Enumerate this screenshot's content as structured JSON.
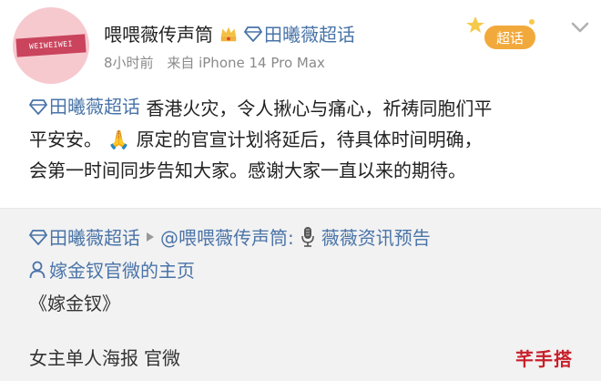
{
  "post": {
    "author_name": "喂喂薇传声筒",
    "author_tag": "田曦薇超话",
    "time": "8小时前",
    "source": "来自 iPhone 14 Pro Max",
    "badge_text": "超话",
    "avatar_text": "WEIWEIWEI",
    "content": {
      "tag": "田曦薇超话",
      "line1": "香港火灾，令人揪心与痛心，祈祷同胞们平",
      "line2_a": "平安安。",
      "line2_emoji": "🙏",
      "line2_b": "原定的官宣计划将延后，待具体时间明确，",
      "line3": "会第一时间同步告知大家。感谢大家一直以来的期待。"
    }
  },
  "repost": {
    "super_topic": "田曦薇超话",
    "author": "@喂喂薇传声筒:",
    "topic": "薇薇资讯预告",
    "homepage_link": "嫁金钗官微的主页",
    "title": "《嫁金钗》",
    "poster_text": "女主单人海报",
    "poster_source": "官微"
  },
  "watermark": "芊手搭",
  "colors": {
    "link": "#4a74a8",
    "watermark": "#c81f2a",
    "repost_bg": "#f2f2f2",
    "meta": "#8a8a8a"
  }
}
